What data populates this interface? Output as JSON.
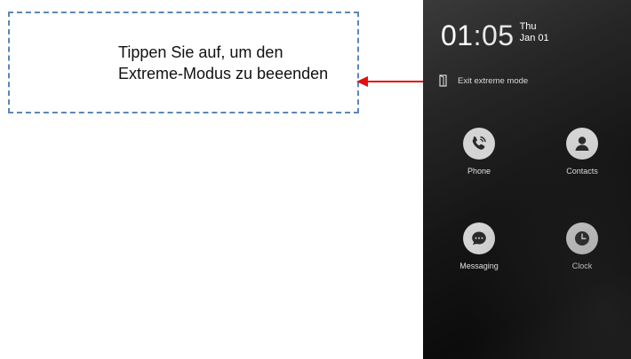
{
  "annotation": {
    "text": "Tippen Sie auf, um den Extreme-Modus zu beeenden",
    "border_color": "#5b86b8",
    "arrow_color": "#e01010"
  },
  "status": {
    "hour": "01",
    "minute": "05",
    "separator": ":",
    "day": "Thu",
    "date": "Jan 01"
  },
  "exit_extreme": {
    "label": "Exit extreme mode",
    "icon": "exit-door-icon"
  },
  "apps": [
    {
      "label": "Phone",
      "icon": "phone-call-icon"
    },
    {
      "label": "Contacts",
      "icon": "person-icon"
    },
    {
      "label": "Messaging",
      "icon": "chat-bubble-icon"
    },
    {
      "label": "Clock",
      "icon": "clock-icon"
    }
  ]
}
